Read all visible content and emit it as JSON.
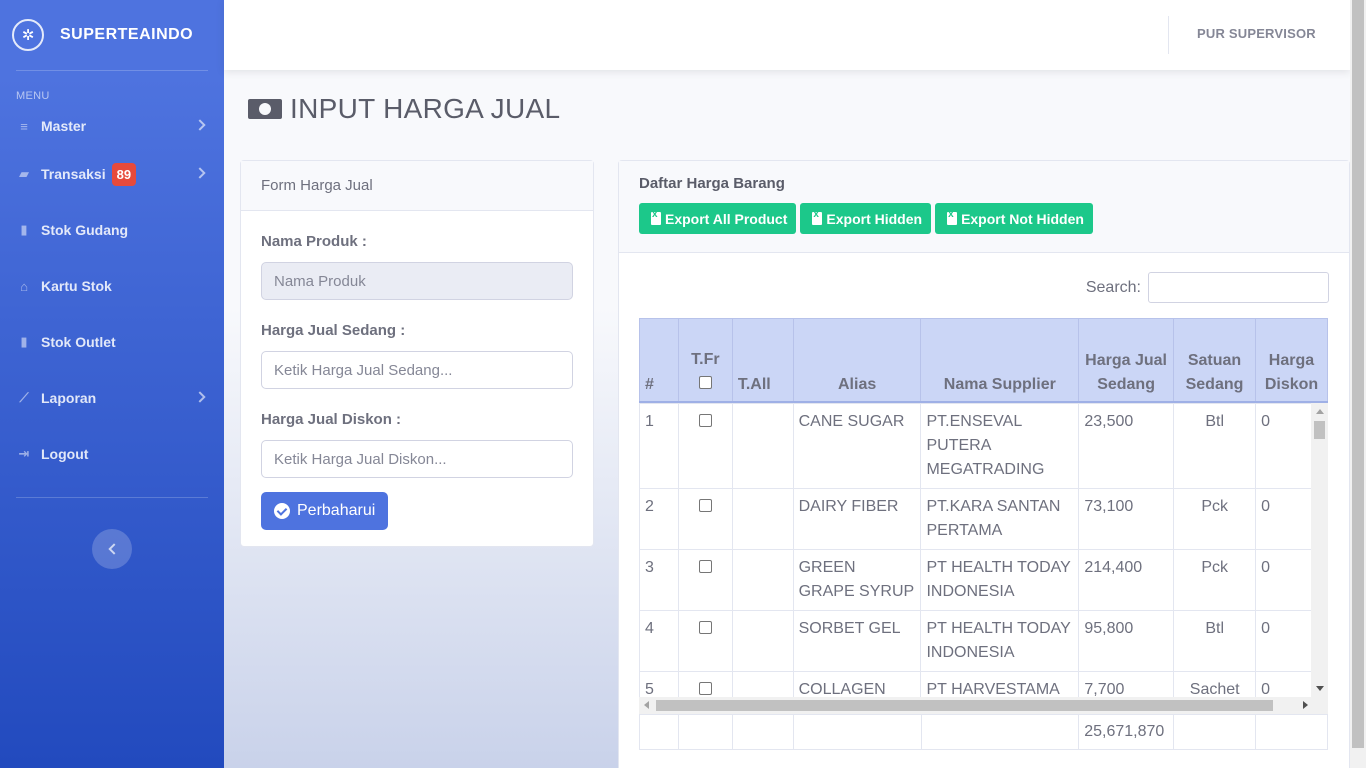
{
  "app": {
    "brand": "SUPERTEAINDO",
    "logo_icon": "tea-leaf-icon"
  },
  "sidebar": {
    "heading": "MENU",
    "items": [
      {
        "label": "Master",
        "icon": "database-icon",
        "has_chevron": true
      },
      {
        "label": "Transaksi",
        "icon": "truck-icon",
        "badge": "89",
        "has_chevron": true
      },
      {
        "label": "Stok Gudang",
        "icon": "clipboard-check-icon"
      },
      {
        "label": "Kartu Stok",
        "icon": "warehouse-icon"
      },
      {
        "label": "Stok Outlet",
        "icon": "clipboard-check-icon"
      },
      {
        "label": "Laporan",
        "icon": "chart-line-icon",
        "has_chevron": true
      },
      {
        "label": "Logout",
        "icon": "sign-out-icon"
      }
    ]
  },
  "topbar": {
    "user_name": "PUR  SUPERVISOR"
  },
  "page": {
    "title": "INPUT HARGA JUAL",
    "title_icon": "money-bill-icon"
  },
  "form": {
    "header": "Form Harga Jual",
    "nama_produk_label": "Nama Produk :",
    "nama_produk_placeholder": "Nama Produk",
    "harga_sedang_label": "Harga Jual Sedang :",
    "harga_sedang_placeholder": "Ketik Harga Jual Sedang...",
    "harga_diskon_label": "Harga Jual Diskon :",
    "harga_diskon_placeholder": "Ketik Harga Jual Diskon...",
    "submit_label": "Perbaharui"
  },
  "list": {
    "title": "Daftar Harga Barang",
    "export_all": "Export All Product",
    "export_hidden": "Export Hidden",
    "export_not_hidden": "Export Not Hidden",
    "search_label": "Search:",
    "search_value": "",
    "columns": {
      "no": "#",
      "tfr": "T.Fr",
      "tall": "T.All",
      "alias": "Alias",
      "supplier": "Nama Supplier",
      "harga_sedang": "Harga Jual Sedang",
      "satuan_sedang": "Satuan Sedang",
      "harga_diskon": "Harga Diskon"
    },
    "rows": [
      {
        "no": "1",
        "tfr": false,
        "tall": "",
        "alias": "CANE SUGAR",
        "supplier": "PT.ENSEVAL PUTERA MEGATRADING",
        "harga_sedang": "23,500",
        "satuan": "Btl",
        "diskon": "0"
      },
      {
        "no": "2",
        "tfr": false,
        "tall": "",
        "alias": "DAIRY FIBER",
        "supplier": "PT.KARA SANTAN PERTAMA",
        "harga_sedang": "73,100",
        "satuan": "Pck",
        "diskon": "0"
      },
      {
        "no": "3",
        "tfr": false,
        "tall": "",
        "alias": "GREEN GRAPE SYRUP",
        "supplier": "PT HEALTH TODAY INDONESIA",
        "harga_sedang": "214,400",
        "satuan": "Pck",
        "diskon": "0"
      },
      {
        "no": "4",
        "tfr": false,
        "tall": "",
        "alias": "SORBET GEL",
        "supplier": "PT HEALTH TODAY INDONESIA",
        "harga_sedang": "95,800",
        "satuan": "Btl",
        "diskon": "0"
      },
      {
        "no": "5",
        "tfr": false,
        "tall": "",
        "alias": "COLLAGEN",
        "supplier": "PT HARVESTAMA",
        "harga_sedang": "7,700",
        "satuan": "Sachet",
        "diskon": "0"
      }
    ],
    "footer_total": "25,671,870"
  }
}
